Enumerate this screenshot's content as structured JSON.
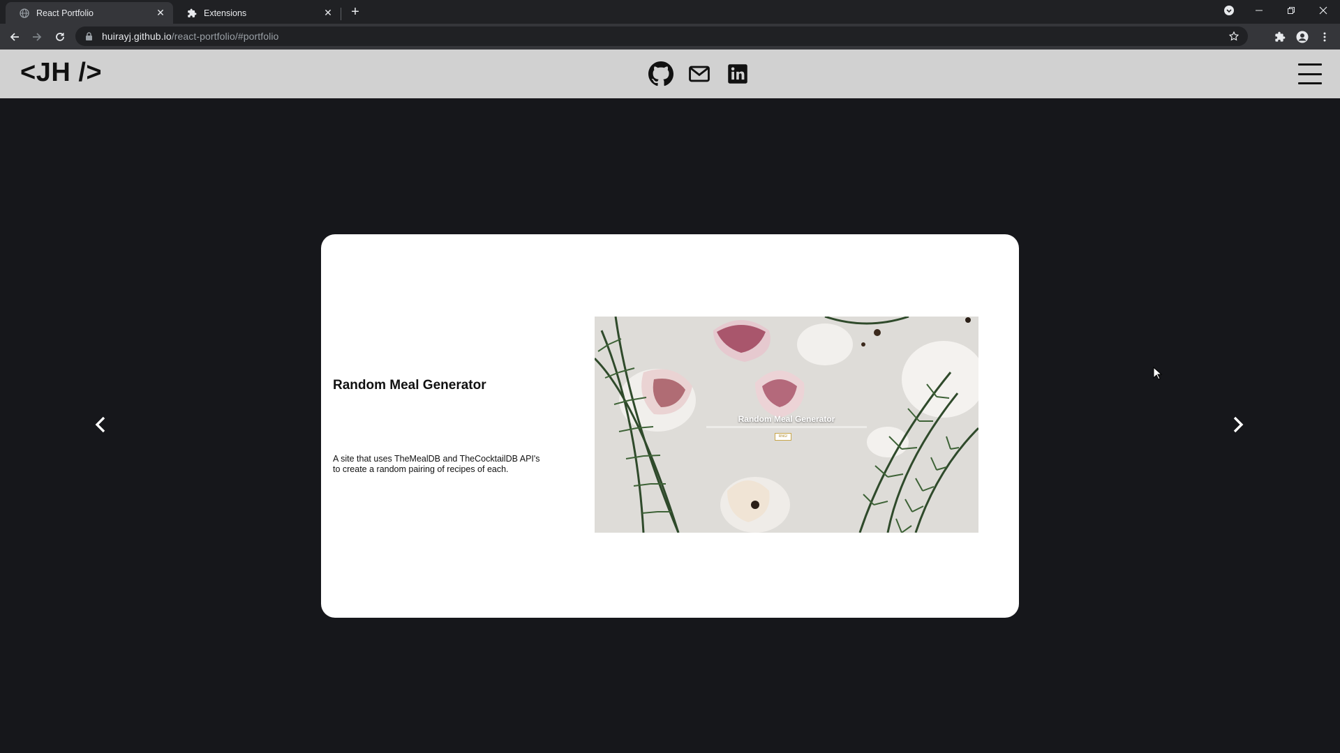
{
  "browser": {
    "tabs": [
      {
        "title": "React Portfolio",
        "icon": "globe-icon",
        "active": true
      },
      {
        "title": "Extensions",
        "icon": "puzzle-icon",
        "active": false
      }
    ],
    "url_host": "huirayj.github.io",
    "url_path": "/react-portfolio/#portfolio"
  },
  "site": {
    "logo": "<JH />",
    "social": [
      "github-icon",
      "mail-icon",
      "linkedin-icon"
    ]
  },
  "project": {
    "title": "Random Meal Generator",
    "description": "A site that uses TheMealDB and TheCocktailDB API's to create a random pairing of recipes of each.",
    "screenshot_title": "Random Meal Generator",
    "screenshot_button": "RNG!"
  },
  "colors": {
    "page_bg": "#16171b",
    "header_bg": "#d1d1d1",
    "card_bg": "#ffffff"
  }
}
